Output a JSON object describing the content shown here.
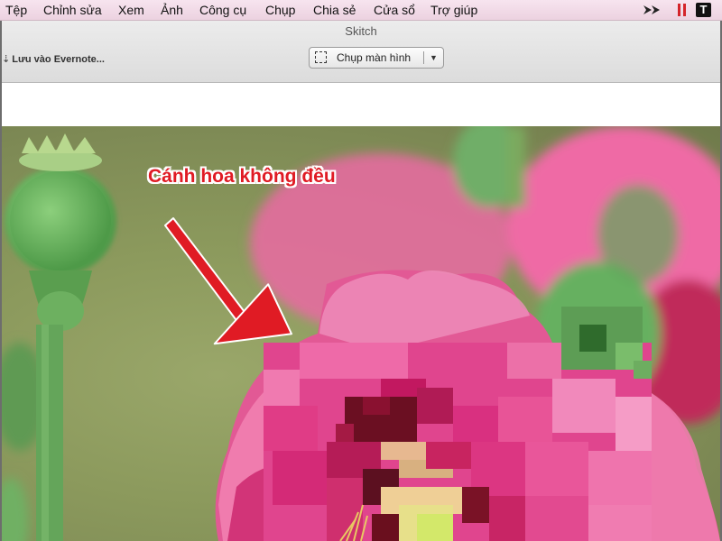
{
  "menubar": {
    "items": [
      "Tệp",
      "Chỉnh sửa",
      "Xem",
      "Ảnh",
      "Công cụ",
      "Chụp",
      "Chia sẻ",
      "Cửa sổ",
      "Trợ giúp"
    ],
    "tray": {
      "skitch_letter": "T",
      "icons": [
        "forward-arrows-icon",
        "pause-icon",
        "skitch-icon"
      ]
    }
  },
  "window": {
    "title": "Skitch",
    "toolbar": {
      "evernote_label": "Lưu vào Evernote...",
      "capture_label": "Chụp màn hình"
    }
  },
  "canvas": {
    "annotation_text": "Cánh hoa không đều",
    "annotation_color": "#e01b24"
  },
  "colors": {
    "menubar_bg": "#f3dbe8",
    "flower_pink": "#e8438f",
    "bud_green": "#6cae5c",
    "annotation_red": "#e01b24"
  }
}
